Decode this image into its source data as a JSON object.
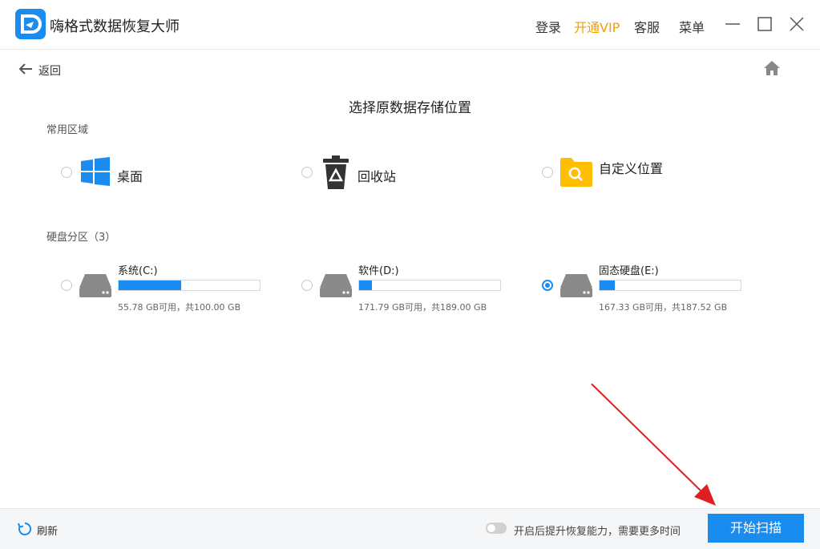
{
  "app": {
    "title": "嗨格式数据恢复大师",
    "accent": "#1a8cf0",
    "vip_color": "#f0a000"
  },
  "topbar": {
    "login": "登录",
    "vip": "开通VIP",
    "service": "客服",
    "menu": "菜单",
    "icons": [
      "minimize-icon",
      "maximize-icon",
      "close-icon"
    ]
  },
  "nav": {
    "back_label": "返回",
    "home_icon": "home-icon"
  },
  "page": {
    "title": "选择原数据存储位置"
  },
  "common": {
    "label": "常用区域",
    "items": [
      {
        "label": "桌面",
        "icon": "windows-icon",
        "selected": false
      },
      {
        "label": "回收站",
        "icon": "recycle-bin-icon",
        "selected": false
      },
      {
        "label": "自定义位置",
        "icon": "folder-search-icon",
        "selected": false
      }
    ]
  },
  "disks": {
    "label": "硬盘分区（3）",
    "items": [
      {
        "name": "系统(C:)",
        "info": "55.78 GB可用，共100.00 GB",
        "used_fraction": 0.442,
        "selected": false
      },
      {
        "name": "软件(D:)",
        "info": "171.79 GB可用，共189.00 GB",
        "used_fraction": 0.091,
        "selected": false
      },
      {
        "name": "固态硬盘(E:)",
        "info": "167.33 GB可用，共187.52 GB",
        "used_fraction": 0.108,
        "selected": true
      }
    ]
  },
  "footer": {
    "refresh": "刷新",
    "toggle_label": "开启后提升恢复能力，需要更多时间",
    "toggle_on": false,
    "scan_button": "开始扫描"
  }
}
